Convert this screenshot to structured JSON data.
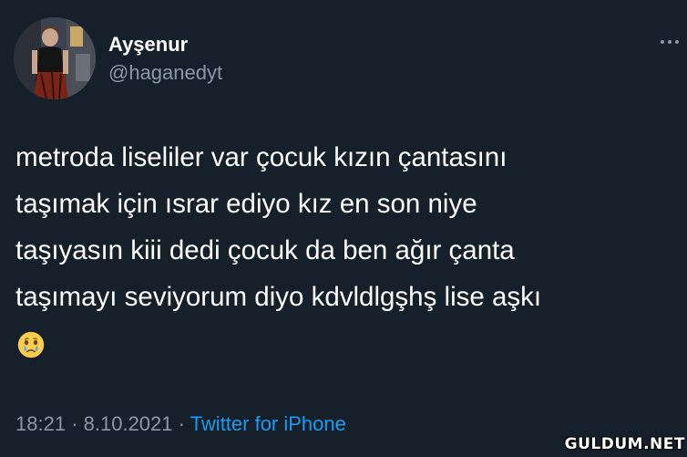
{
  "author": {
    "display_name": "Ayşenur",
    "handle": "@haganedyt"
  },
  "more_icon": "more-horizontal-icon",
  "tweet": {
    "lines": [
      "metroda liseliler var çocuk kızın çantasını",
      "taşımak için ısrar ediyo kız en son niye",
      "taşıyasın kiii dedi çocuk da ben ağır çanta",
      "taşımayı seviyorum diyo kdvldlgşhş lise aşkı"
    ],
    "emoji": "face-holding-back-tears-emoji"
  },
  "meta": {
    "time": "18:21",
    "separator": "·",
    "date": "8.10.2021",
    "source": "Twitter for iPhone"
  },
  "watermark": "GULDUM.NET",
  "colors": {
    "background": "#15202b",
    "text": "#ffffff",
    "secondary": "#8b98a5",
    "link": "#1d9bf0"
  }
}
